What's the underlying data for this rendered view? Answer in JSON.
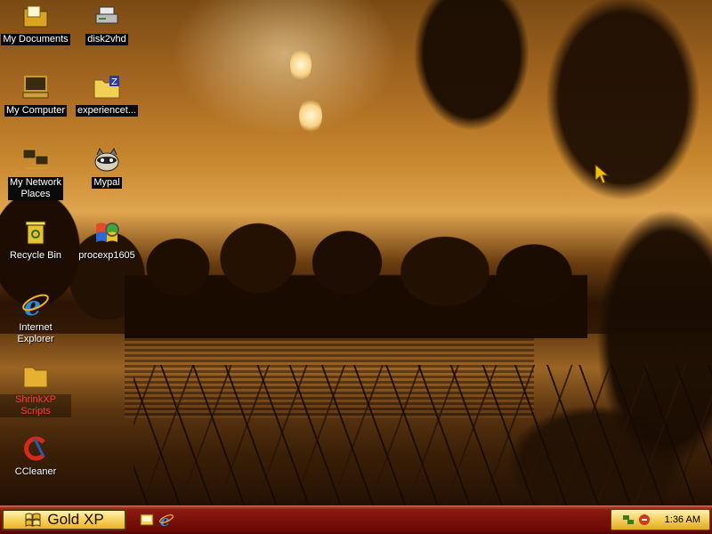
{
  "desktop": {
    "icons": [
      {
        "label": "My Documents",
        "icon": "folder-icon"
      },
      {
        "label": "disk2vhd",
        "icon": "drive-icon"
      },
      {
        "label": "My Computer",
        "icon": "computer-icon"
      },
      {
        "label": "experiencet...",
        "icon": "zip-folder-icon"
      },
      {
        "label": "My Network\nPlaces",
        "icon": "network-icon"
      },
      {
        "label": "Mypal",
        "icon": "raccoon-icon"
      },
      {
        "label": "Recycle Bin",
        "icon": "recycle-bin-icon"
      },
      {
        "label": "procexp1605",
        "icon": "process-explorer-icon"
      },
      {
        "label": "Internet\nExplorer",
        "icon": "ie-icon"
      },
      {
        "label": "ShrinkXP Scripts",
        "icon": "folder-icon"
      },
      {
        "label": "CCleaner",
        "icon": "ccleaner-icon"
      }
    ]
  },
  "taskbar": {
    "start_label": "Gold XP",
    "quick_launch": [
      "show-desktop-icon",
      "ie-icon"
    ],
    "tray_icons": [
      "network-tray-icon",
      "security-tray-icon"
    ],
    "clock": "1:36 AM"
  },
  "colors": {
    "taskbar": "#7a100a",
    "start_button": "#f7d565",
    "shrink_label": "#ff3a3a"
  }
}
